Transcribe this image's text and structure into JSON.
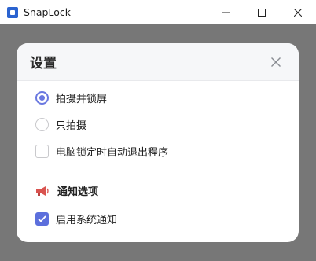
{
  "window": {
    "title": "SnapLock",
    "app_icon": "snaplock-app-icon",
    "controls": [
      "minimize-icon",
      "maximize-icon",
      "close-icon"
    ]
  },
  "dialog": {
    "title": "设置",
    "close_icon": "close-icon",
    "lock_mode": {
      "options": [
        {
          "label": "拍摄并锁屏",
          "selected": true
        },
        {
          "label": "只拍摄",
          "selected": false
        }
      ]
    },
    "auto_exit": {
      "label": "电脑锁定时自动退出程序",
      "checked": false
    },
    "notifications": {
      "section_title": "通知选项",
      "section_icon": "megaphone-icon",
      "enable": {
        "label": "启用系统通知",
        "checked": true
      }
    }
  },
  "colors": {
    "accent": "#5c6fdc",
    "radio_accent": "#6a78e0",
    "megaphone": "#d9534f"
  }
}
